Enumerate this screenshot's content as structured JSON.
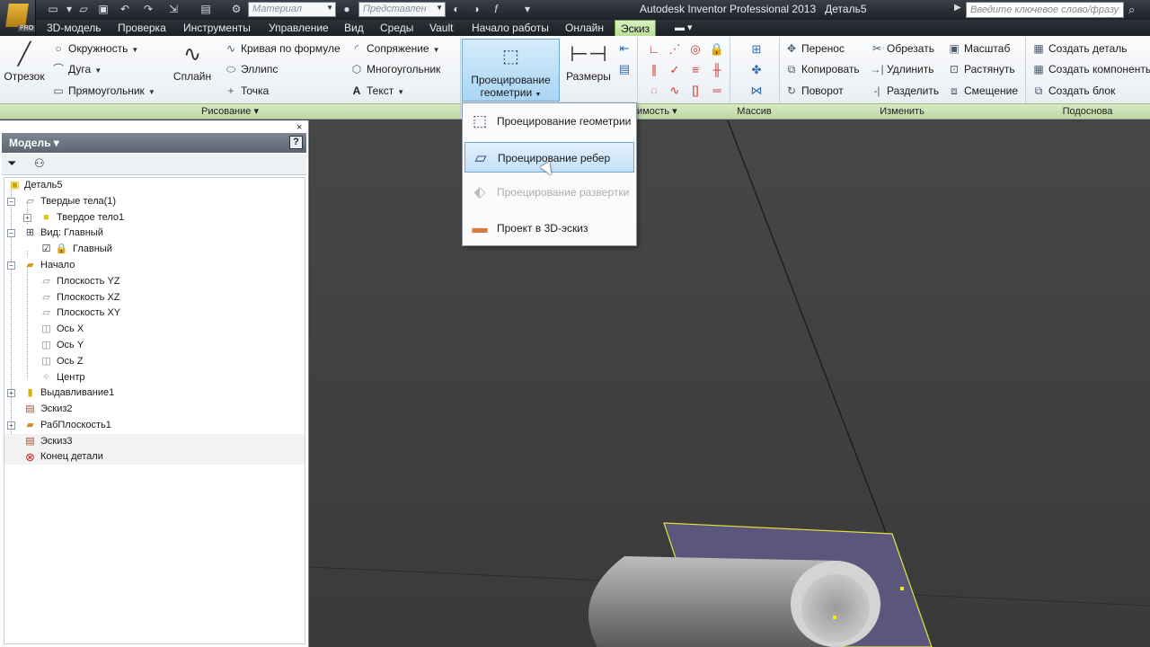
{
  "titlebar": {
    "material": "Материал",
    "appearance": "Представлен",
    "title": "Autodesk Inventor Professional 2013",
    "document": "Деталь5",
    "search_placeholder": "Введите ключевое слово/фразу",
    "pro_badge": "PRO"
  },
  "tabs": [
    "3D-модель",
    "Проверка",
    "Инструменты",
    "Управление",
    "Вид",
    "Среды",
    "Vault",
    "Начало работы",
    "Онлайн",
    "Эскиз"
  ],
  "ribbon": {
    "draw": {
      "line": "Отрезок",
      "circle": "Окружность",
      "arc": "Дуга",
      "rectangle": "Прямоугольник",
      "spline": "Сплайн",
      "equation_curve": "Кривая по формуле",
      "ellipse": "Эллипс",
      "point": "Точка",
      "fillet": "Сопряжение",
      "polygon": "Многоугольник",
      "text": "Текст",
      "group_label": "Рисование"
    },
    "project": {
      "label_line1": "Проецирование",
      "label_line2": "геометрии"
    },
    "dimension": {
      "label": "Размеры"
    },
    "constrain": {
      "group_label": "имость"
    },
    "pattern": {
      "group_label": "Массив"
    },
    "modify": {
      "move": "Перенос",
      "copy": "Копировать",
      "rotate": "Поворот",
      "trim": "Обрезать",
      "extend": "Удлинить",
      "split": "Разделить",
      "scale": "Масштаб",
      "stretch": "Растянуть",
      "offset": "Смещение",
      "group_label": "Изменить"
    },
    "layout": {
      "make_part": "Создать деталь",
      "make_components": "Создать компоненты",
      "create_block": "Создать блок",
      "group_label": "Подоснова"
    }
  },
  "dropdown": {
    "items": [
      {
        "label": "Проецирование геометрии",
        "state": "normal"
      },
      {
        "label": "Проецирование ребер",
        "state": "hover"
      },
      {
        "label": "Проецирование развертки",
        "state": "disabled"
      },
      {
        "label": "Проект в 3D-эскиз",
        "state": "normal"
      }
    ]
  },
  "browser": {
    "title": "Модель",
    "help": "?",
    "close": "×",
    "tree": [
      {
        "label": "Деталь5",
        "level": 0
      },
      {
        "label": "Твердые тела(1)",
        "level": 1
      },
      {
        "label": "Твердое тело1",
        "level": 2
      },
      {
        "label": "Вид: Главный",
        "level": 1
      },
      {
        "label": "Главный",
        "level": 2
      },
      {
        "label": "Начало",
        "level": 1
      },
      {
        "label": "Плоскость YZ",
        "level": 2
      },
      {
        "label": "Плоскость XZ",
        "level": 2
      },
      {
        "label": "Плоскость XY",
        "level": 2
      },
      {
        "label": "Ось X",
        "level": 2
      },
      {
        "label": "Ось Y",
        "level": 2
      },
      {
        "label": "Ось Z",
        "level": 2
      },
      {
        "label": "Центр",
        "level": 2
      },
      {
        "label": "Выдавливание1",
        "level": 1
      },
      {
        "label": "Эскиз2",
        "level": 1
      },
      {
        "label": "РабПлоскость1",
        "level": 1
      },
      {
        "label": "Эскиз3",
        "level": 1
      },
      {
        "label": "Конец детали",
        "level": 1
      }
    ]
  },
  "colors": {
    "active_tab": "#c6e7a8",
    "hover": "#c4e0f7",
    "sketch_plane": "#5a567c",
    "plane_outline": "#e3e33a"
  }
}
